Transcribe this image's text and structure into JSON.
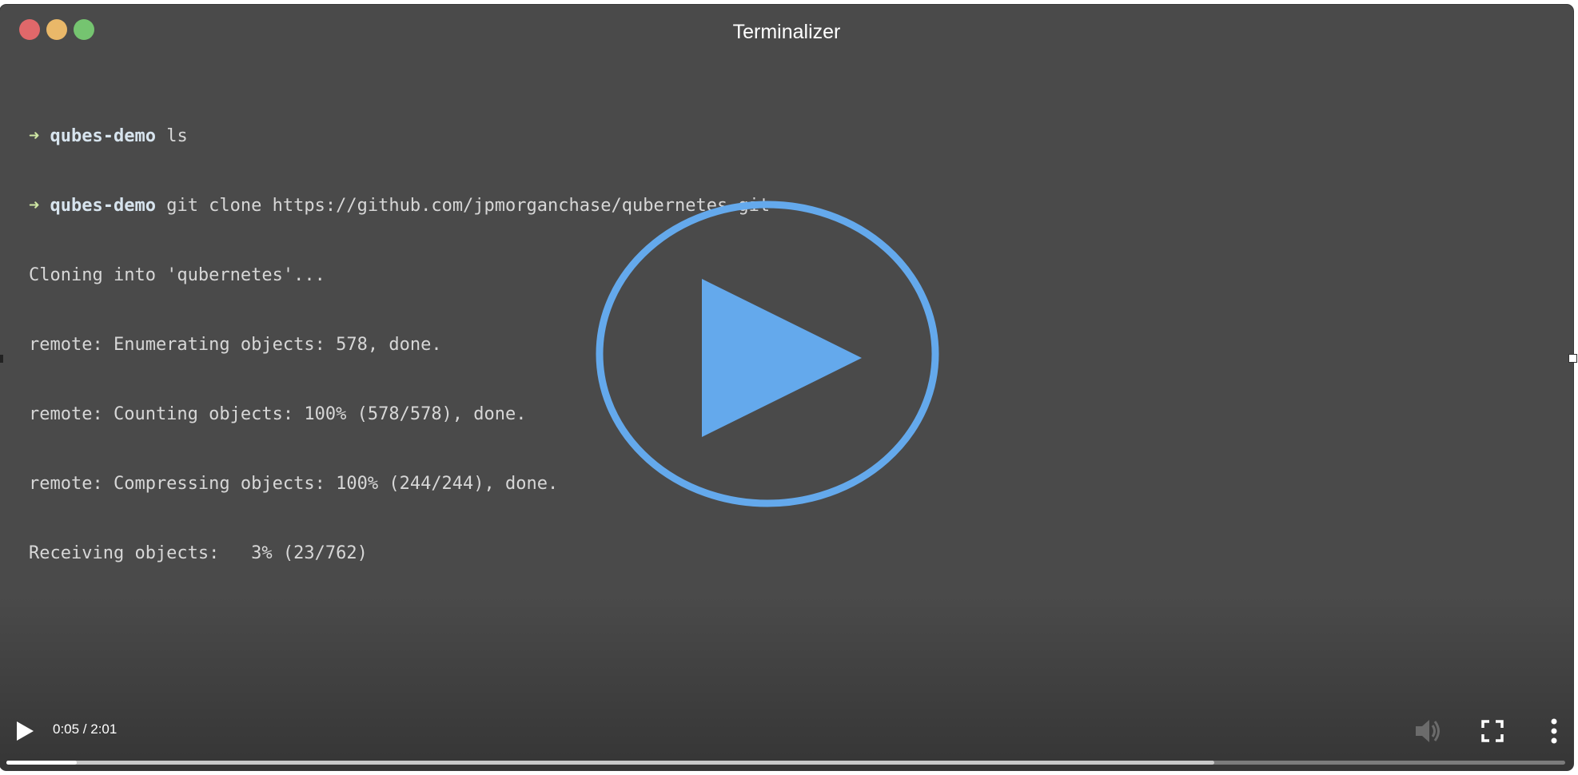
{
  "window": {
    "title": "Terminalizer"
  },
  "terminal": {
    "lines": [
      {
        "prompt": "➜",
        "dir": "qubes-demo",
        "cmd": " ls"
      },
      {
        "prompt": "➜",
        "dir": "qubes-demo",
        "cmd": " git clone https://github.com/jpmorganchase/qubernetes.git"
      },
      {
        "text": "Cloning into 'qubernetes'..."
      },
      {
        "text": "remote: Enumerating objects: 578, done."
      },
      {
        "text": "remote: Counting objects: 100% (578/578), done."
      },
      {
        "text": "remote: Compressing objects: 100% (244/244), done."
      },
      {
        "text": "Receiving objects:   3% (23/762)"
      }
    ]
  },
  "player": {
    "time_display": "0:05 / 2:01",
    "progress_played_fraction": 0.045,
    "progress_buffered_fraction": 0.775,
    "accent_color": "#64a9ec",
    "icons": {
      "big_play": "play-circle-icon",
      "play": "play-icon",
      "volume": "volume-muted-icon",
      "fullscreen": "fullscreen-icon",
      "more": "more-vertical-icon"
    }
  }
}
